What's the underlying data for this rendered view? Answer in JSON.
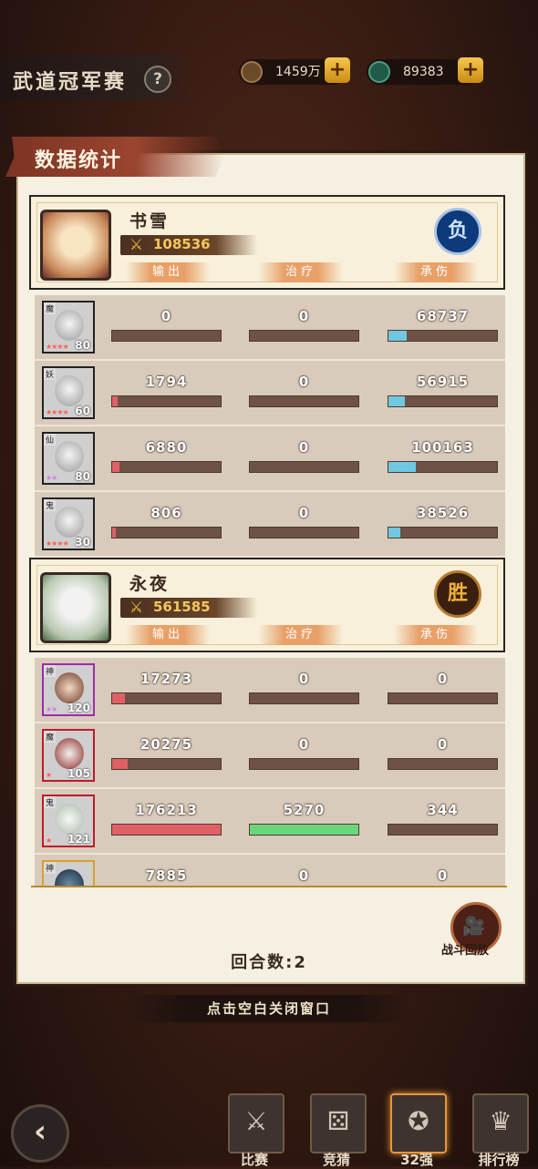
{
  "header": {
    "title": "武道冠军赛",
    "help": "?"
  },
  "currency": [
    {
      "value": "1459万",
      "color": "#6b4a2a"
    },
    {
      "value": "89383",
      "color": "#1f5a4a"
    }
  ],
  "panel": {
    "title": "数据统计"
  },
  "stat_labels": {
    "dmg": "输出",
    "heal": "治疗",
    "tank": "承伤"
  },
  "players": [
    {
      "name": "书雪",
      "power": "108536",
      "result": "负",
      "heroes": [
        {
          "faction": "魔",
          "level": "80",
          "dmg": "0",
          "heal": "0",
          "tank": "68737",
          "dmg_pct": 0,
          "heal_pct": 0,
          "tank_pct": 0.17
        },
        {
          "faction": "妖",
          "level": "60",
          "dmg": "1794",
          "heal": "0",
          "tank": "56915",
          "dmg_pct": 0.05,
          "heal_pct": 0,
          "tank_pct": 0.15
        },
        {
          "faction": "仙",
          "level": "80",
          "dmg": "6880",
          "heal": "0",
          "tank": "100163",
          "dmg_pct": 0.07,
          "heal_pct": 0,
          "tank_pct": 0.25
        },
        {
          "faction": "鬼",
          "level": "30",
          "dmg": "806",
          "heal": "0",
          "tank": "38526",
          "dmg_pct": 0.03,
          "heal_pct": 0,
          "tank_pct": 0.11
        }
      ]
    },
    {
      "name": "永夜",
      "power": "561585",
      "result": "胜",
      "heroes": [
        {
          "faction": "神",
          "level": "120",
          "dmg": "17273",
          "heal": "0",
          "tank": "0",
          "dmg_pct": 0.12,
          "heal_pct": 0,
          "tank_pct": 0
        },
        {
          "faction": "魔",
          "level": "105",
          "dmg": "20275",
          "heal": "0",
          "tank": "0",
          "dmg_pct": 0.14,
          "heal_pct": 0,
          "tank_pct": 0
        },
        {
          "faction": "鬼",
          "level": "121",
          "dmg": "176213",
          "heal": "5270",
          "tank": "344",
          "dmg_pct": 1.0,
          "heal_pct": 1.0,
          "tank_pct": 0
        },
        {
          "faction": "神",
          "level": "",
          "dmg": "7885",
          "heal": "0",
          "tank": "0",
          "dmg_pct": 0,
          "heal_pct": 0,
          "tank_pct": 0
        }
      ]
    }
  ],
  "rounds": "回合数:2",
  "replay": "战斗回放",
  "close_hint": "点击空白关闭窗口",
  "nav": [
    {
      "label": "比赛",
      "icon": "⚔"
    },
    {
      "label": "竞猜",
      "icon": "⚄"
    },
    {
      "label": "32强",
      "icon": "✪"
    },
    {
      "label": "排行榜",
      "icon": "♛"
    }
  ]
}
